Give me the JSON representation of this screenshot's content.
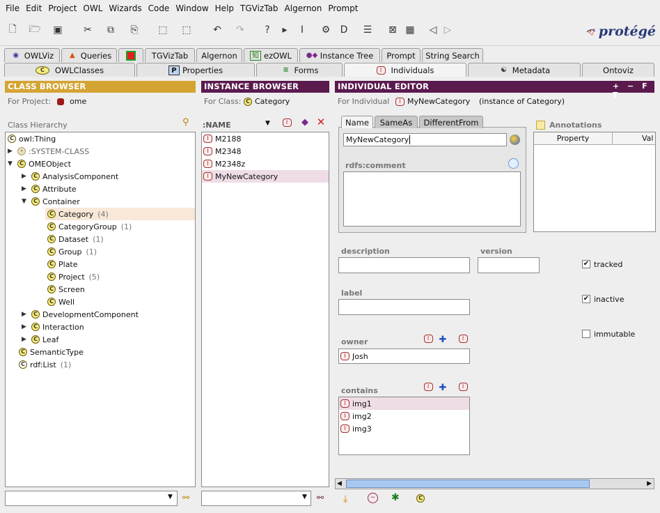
{
  "menu": [
    "File",
    "Edit",
    "Project",
    "OWL",
    "Wizards",
    "Code",
    "Window",
    "Help",
    "TGVizTab",
    "Algernon",
    "Prompt"
  ],
  "logo": "protégé",
  "tabs_row1": [
    "OWLViz",
    "Queries",
    "",
    "TGVizTab",
    "Algernon",
    "ezOWL",
    "Instance Tree",
    "Prompt",
    "String Search"
  ],
  "tabs_row2": [
    "OWLClasses",
    "Properties",
    "Forms",
    "Individuals",
    "Metadata",
    "Ontoviz"
  ],
  "class_browser": {
    "title": "CLASS BROWSER",
    "for_project_label": "For Project:",
    "project": "ome",
    "hierarchy_label": "Class Hierarchy",
    "items": [
      {
        "label": "owl:Thing",
        "count": ""
      },
      {
        "label": ":SYSTEM-CLASS",
        "count": ""
      },
      {
        "label": "OMEObject",
        "count": ""
      },
      {
        "label": "AnalysisComponent",
        "count": ""
      },
      {
        "label": "Attribute",
        "count": ""
      },
      {
        "label": "Container",
        "count": ""
      },
      {
        "label": "Category",
        "count": "(4)"
      },
      {
        "label": "CategoryGroup",
        "count": "(1)"
      },
      {
        "label": "Dataset",
        "count": "(1)"
      },
      {
        "label": "Group",
        "count": "(1)"
      },
      {
        "label": "Plate",
        "count": ""
      },
      {
        "label": "Project",
        "count": "(5)"
      },
      {
        "label": "Screen",
        "count": ""
      },
      {
        "label": "Well",
        "count": ""
      },
      {
        "label": "DevelopmentComponent",
        "count": ""
      },
      {
        "label": "Interaction",
        "count": ""
      },
      {
        "label": "Leaf",
        "count": ""
      },
      {
        "label": "SemanticType",
        "count": ""
      },
      {
        "label": "rdf:List",
        "count": "(1)"
      }
    ]
  },
  "instance_browser": {
    "title": "INSTANCE BROWSER",
    "for_class_label": "For Class:",
    "class": "Category",
    "column": ":NAME",
    "items": [
      "M2188",
      "M2348",
      "M2348z",
      "MyNewCategory"
    ]
  },
  "individual_editor": {
    "title": "INDIVIDUAL EDITOR",
    "title_buttons": "+ − F T",
    "for_label": "For Individual",
    "individual": "MyNewCategory",
    "instance_of": "(instance of Category)",
    "subtabs": [
      "Name",
      "SameAs",
      "DifferentFrom"
    ],
    "name_value": "MyNewCategory",
    "rdfs_comment_label": "rdfs:comment",
    "annotations_label": "Annotations",
    "annotations_columns": [
      "Property",
      "Val"
    ],
    "description_label": "description",
    "version_label": "version",
    "label_label": "label",
    "tracked_label": "tracked",
    "inactive_label": "inactive",
    "immutable_label": "immutable",
    "owner_label": "owner",
    "owner_value": "Josh",
    "contains_label": "contains",
    "contains_items": [
      "img1",
      "img2",
      "img3"
    ]
  },
  "colors": {
    "class_title": "#d4a433",
    "instance_title": "#5b1a4e",
    "editor_title": "#5b1a4e",
    "selection": "#f8e8d8",
    "selection_pink": "#eedde6"
  }
}
